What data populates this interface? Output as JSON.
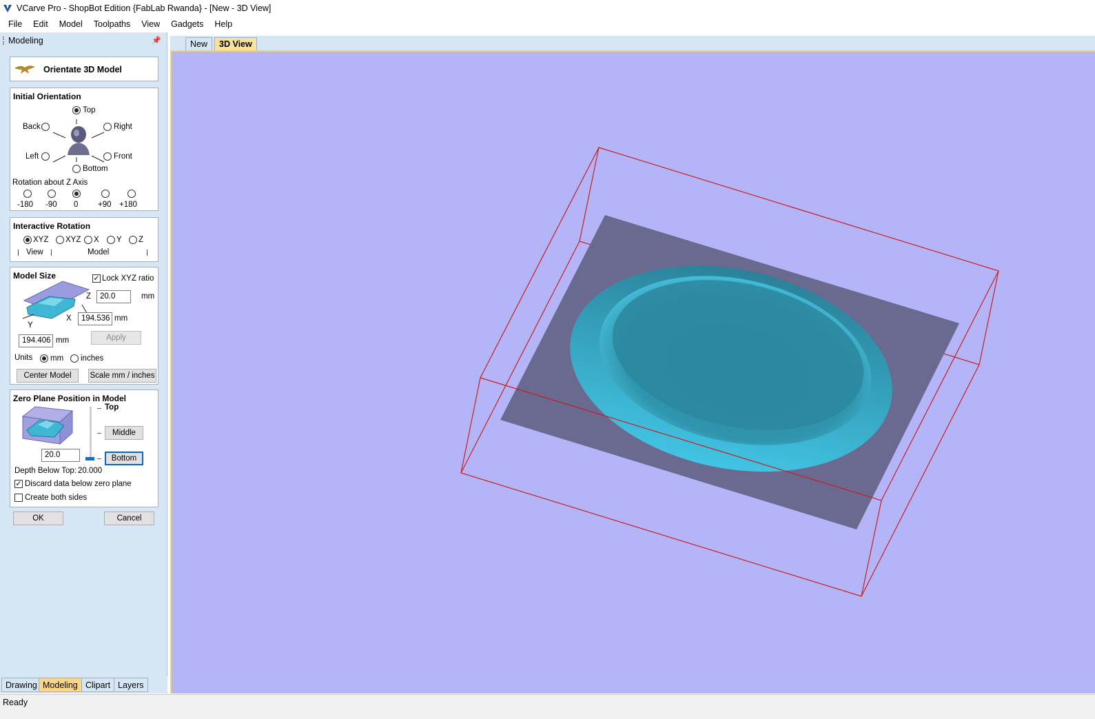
{
  "window": {
    "title": "VCarve Pro - ShopBot Edition {FabLab Rwanda} - [New - 3D View]"
  },
  "menu": [
    "File",
    "Edit",
    "Model",
    "Toolpaths",
    "View",
    "Gadgets",
    "Help"
  ],
  "pane": {
    "title": "Modeling",
    "header": "Orientate 3D Model",
    "initial_orientation": {
      "title": "Initial Orientation",
      "options": {
        "top": "Top",
        "back": "Back",
        "right": "Right",
        "left": "Left",
        "front": "Front",
        "bottom": "Bottom"
      },
      "selected": "Top",
      "rotation_label": "Rotation about Z Axis",
      "rotation_options": [
        "-180",
        "-90",
        "0",
        "+90",
        "+180"
      ],
      "rotation_selected": "0"
    },
    "interactive_rotation": {
      "title": "Interactive Rotation",
      "options": [
        "XYZ",
        "XYZ",
        "X",
        "Y",
        "Z"
      ],
      "selected": "XYZ",
      "view_label": "View",
      "model_label": "Model"
    },
    "model_size": {
      "title": "Model Size",
      "lock_label": "Lock XYZ ratio",
      "lock_checked": true,
      "z_label": "Z",
      "z_value": "20.0",
      "x_label": "X",
      "x_value": "194.536",
      "y_label": "Y",
      "y_value": "194.406",
      "unit": "mm",
      "apply": "Apply",
      "units_label": "Units",
      "units_mm": "mm",
      "units_inches": "inches",
      "units_selected": "mm",
      "center_model": "Center Model",
      "scale_button": "Scale mm / inches"
    },
    "zero_plane": {
      "title": "Zero Plane Position in Model",
      "top": "Top",
      "middle": "Middle",
      "bottom": "Bottom",
      "value": "20.0",
      "depth_label": "Depth Below Top:",
      "depth_value": "20.000",
      "discard_label": "Discard data below zero plane",
      "discard_checked": true,
      "both_sides_label": "Create both sides",
      "both_sides_checked": false
    },
    "ok": "OK",
    "cancel": "Cancel"
  },
  "doc_tabs": [
    "New",
    "3D View"
  ],
  "active_doc_tab": "3D View",
  "bottom_tabs": [
    "Drawing",
    "Modeling",
    "Clipart",
    "Layers"
  ],
  "active_bottom_tab": "Modeling",
  "status": "Ready",
  "colors": {
    "viewport_bg": "#b4b4f8",
    "model": "#2fa9c8",
    "bounding_box": "#c81e1e",
    "plane": "#6a6a90"
  }
}
